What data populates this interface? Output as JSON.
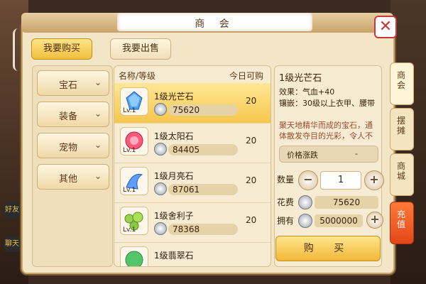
{
  "title": "商  会",
  "tabs": {
    "buy": "我要购买",
    "sell": "我要出售"
  },
  "categories": [
    "宝石",
    "装备",
    "宠物",
    "其他"
  ],
  "list": {
    "header_name": "名称/等级",
    "header_today": "今日可购",
    "items": [
      {
        "name": "1级光芒石",
        "price": "75620",
        "today": "20",
        "lv": "Lv.1",
        "color": "#4aa3ff"
      },
      {
        "name": "1级太阳石",
        "price": "84405",
        "today": "20",
        "lv": "Lv.1",
        "color": "#ff5a7a"
      },
      {
        "name": "1级月亮石",
        "price": "87061",
        "today": "20",
        "lv": "Lv.1",
        "color": "#5f9dff"
      },
      {
        "name": "1级舍利子",
        "price": "78368",
        "today": "20",
        "lv": "Lv.1",
        "color": "#9ad24f"
      },
      {
        "name": "1级翡翠石",
        "price": "",
        "today": "",
        "lv": "",
        "color": "#53c66b"
      }
    ]
  },
  "detail": {
    "title": "1级光芒石",
    "effect": "效果：气血+40",
    "inlay": "镶嵌：30级以上衣甲、腰带",
    "desc": "聚天地精华而成的宝石，通体散发夺目的光彩，令人不",
    "trend_label": "价格涨跌",
    "trend_value": "-"
  },
  "purchase": {
    "qty_label": "数量",
    "qty": "1",
    "fee_label": "花费",
    "fee_value": "75620",
    "own_label": "拥有",
    "own_value": "5000000",
    "buy_button": "购 买"
  },
  "side_tabs": [
    "商会",
    "摆摊",
    "商城",
    "充值"
  ],
  "left_icons": [
    "好友",
    "聊天"
  ]
}
